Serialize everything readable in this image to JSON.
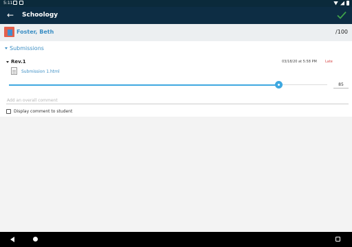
{
  "status": {
    "time": "5:11"
  },
  "appbar": {
    "title": "Schoology",
    "accent": "#3fa24a"
  },
  "student": {
    "name": "Foster, Beth",
    "score_total": "/100"
  },
  "submissions": {
    "section_label": "Submissions",
    "revision": {
      "label": "Rev.1",
      "date": "03/18/20 at 5:58 PM",
      "late_label": "Late",
      "file_name": "Submission 1.html"
    }
  },
  "grading": {
    "score_value": "85",
    "score_fraction": 0.85,
    "comment_placeholder": "Add an overall comment",
    "display_comment_label": "Display comment to student"
  },
  "colors": {
    "app_bar": "#0d2d44",
    "status_bar": "#0b2a3b",
    "link": "#3b8ec4",
    "slider": "#3ea8e0",
    "late": "#d64545"
  }
}
